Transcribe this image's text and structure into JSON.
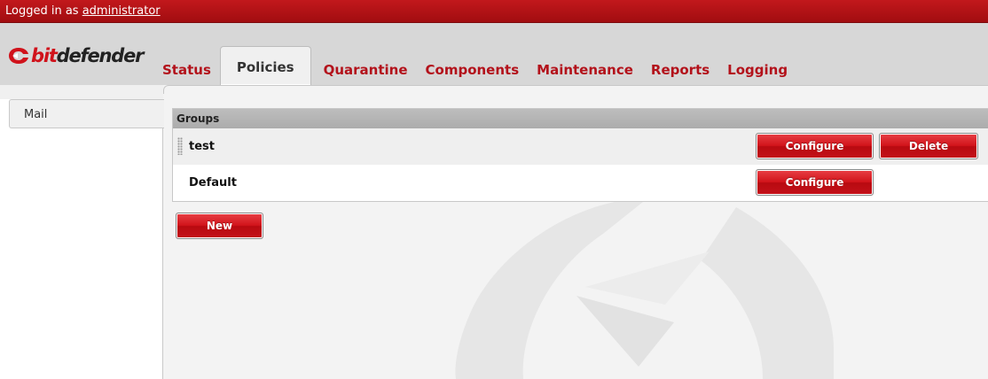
{
  "topbar": {
    "logged_in_prefix": "Logged in as",
    "username": "administrator"
  },
  "logo": {
    "bit": "bit",
    "defender": "defender"
  },
  "tabs": [
    {
      "label": "Status"
    },
    {
      "label": "Policies"
    },
    {
      "label": "Quarantine"
    },
    {
      "label": "Components"
    },
    {
      "label": "Maintenance"
    },
    {
      "label": "Reports"
    },
    {
      "label": "Logging"
    }
  ],
  "active_tab": "Policies",
  "sidebar": {
    "items": [
      {
        "label": "Mail"
      }
    ]
  },
  "groups": {
    "header": "Groups",
    "rows": [
      {
        "name": "test",
        "configure_label": "Configure",
        "delete_label": "Delete"
      },
      {
        "name": "Default",
        "configure_label": "Configure"
      }
    ]
  },
  "new_button": "New",
  "colors": {
    "brand_red": "#c2181c",
    "tab_text": "#b3121b"
  }
}
